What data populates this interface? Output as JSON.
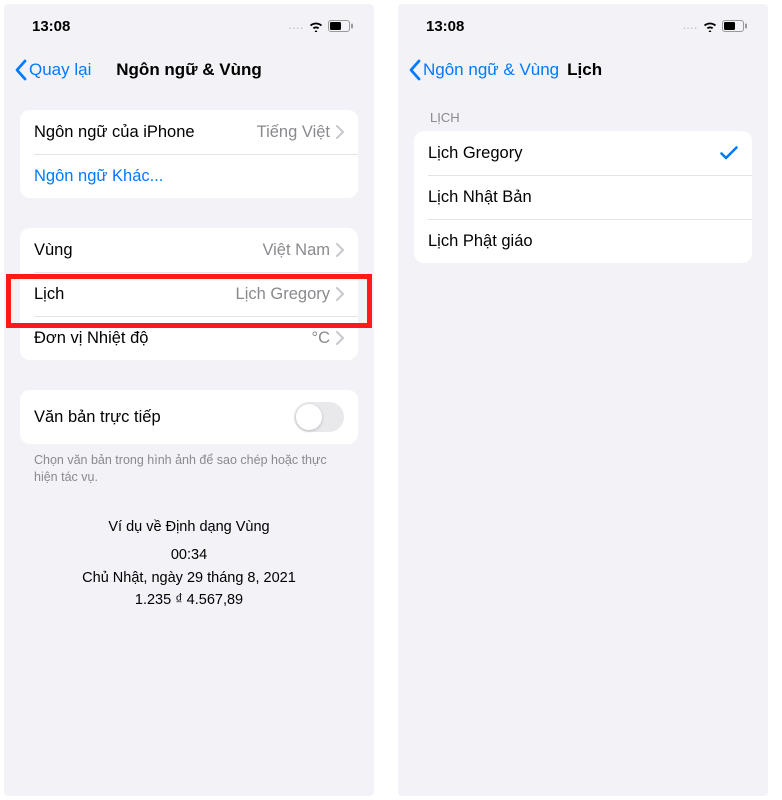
{
  "status": {
    "time": "13:08",
    "dots": "....",
    "wifi": "wifi",
    "battery": "battery"
  },
  "left": {
    "back_label": "Quay lại",
    "title": "Ngôn ngữ & Vùng",
    "rows": {
      "iphone_lang_label": "Ngôn ngữ của iPhone",
      "iphone_lang_value": "Tiếng Việt",
      "other_lang": "Ngôn ngữ Khác...",
      "region_label": "Vùng",
      "region_value": "Việt Nam",
      "calendar_label": "Lịch",
      "calendar_value": "Lịch Gregory",
      "temp_label": "Đơn vị Nhiệt độ",
      "temp_value": "°C",
      "live_text_label": "Văn bản trực tiếp"
    },
    "footer_note": "Chọn văn bản trong hình ảnh để sao chép hoặc thực hiện tác vụ.",
    "example": {
      "title": "Ví dụ về Định dạng Vùng",
      "time": "00:34",
      "date": "Chủ Nhật, ngày 29 tháng 8, 2021",
      "numbers": "1.235 ₫    4.567,89"
    }
  },
  "right": {
    "back_label": "Ngôn ngữ & Vùng",
    "title": "Lịch",
    "section_header": "LỊCH",
    "options": {
      "o1": "Lịch Gregory",
      "o2": "Lịch Nhật Bản",
      "o3": "Lịch Phật giáo"
    },
    "selected": 0
  }
}
